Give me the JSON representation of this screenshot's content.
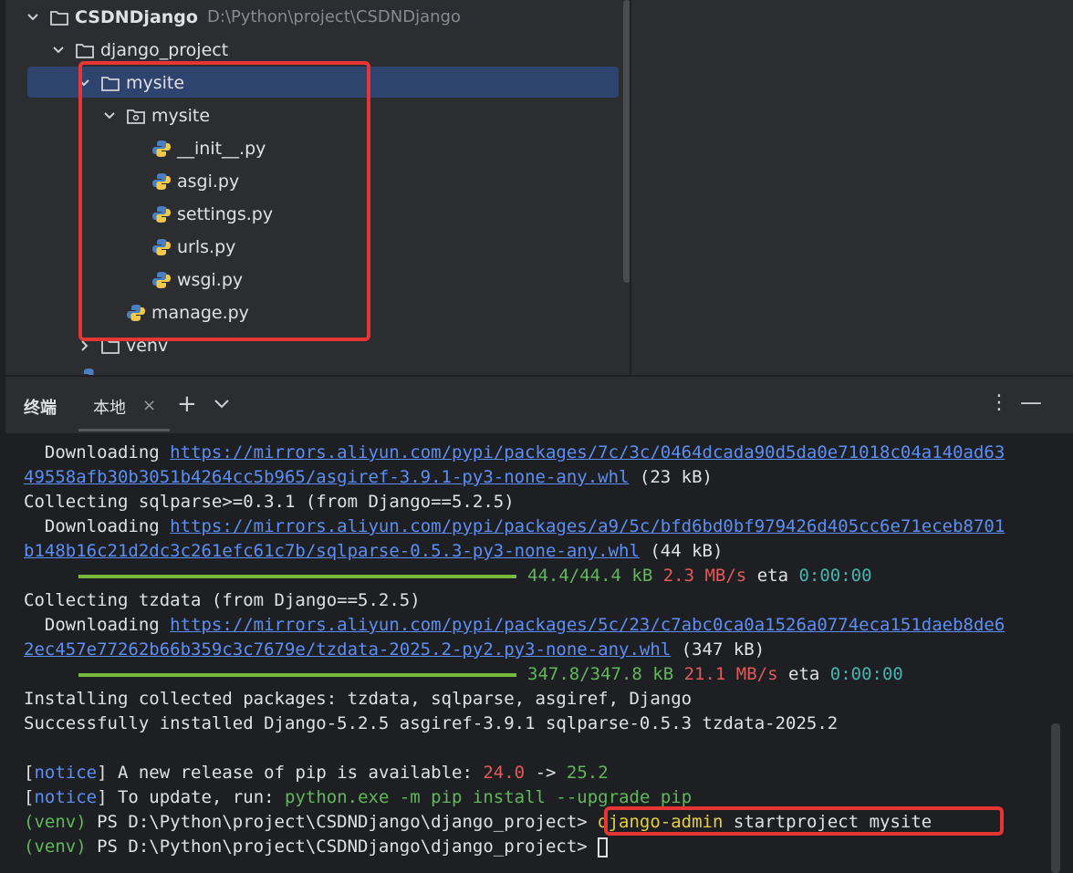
{
  "project_tree": {
    "root": {
      "name": "CSDNDjango",
      "path": "D:\\Python\\project\\CSDNDjango"
    },
    "items": [
      {
        "name": "django_project",
        "type": "folder"
      },
      {
        "name": "mysite",
        "type": "folder"
      },
      {
        "name": "mysite",
        "type": "package"
      },
      {
        "name": "__init__.py",
        "type": "python"
      },
      {
        "name": "asgi.py",
        "type": "python"
      },
      {
        "name": "settings.py",
        "type": "python"
      },
      {
        "name": "urls.py",
        "type": "python"
      },
      {
        "name": "wsgi.py",
        "type": "python"
      },
      {
        "name": "manage.py",
        "type": "python"
      },
      {
        "name": "venv",
        "type": "folder"
      }
    ]
  },
  "terminal_header": {
    "title": "终端",
    "tab_label": "本地",
    "close_glyph": "×",
    "add_glyph": "+",
    "more_glyph": "⋮",
    "minimize_glyph": "—"
  },
  "terminal": {
    "l1_prefix": "  Downloading ",
    "l1_link": "https://mirrors.aliyun.com/pypi/packages/7c/3c/0464dcada90d5da0e71018c04a140ad63",
    "l2_link": "49558afb30b3051b4264cc5b965/asgiref-3.9.1-py3-none-any.whl",
    "l2_size": " (23 kB)",
    "l3": "Collecting sqlparse>=0.3.1 (from Django==5.2.5)",
    "l4_prefix": "  Downloading ",
    "l4_link": "https://mirrors.aliyun.com/pypi/packages/a9/5c/bfd6bd0bf979426d405cc6e71eceb8701",
    "l5_link": "b148b16c21d2dc3c261efc61c7b/sqlparse-0.5.3-py3-none-any.whl",
    "l5_size": " (44 kB)",
    "p1_size": "44.4/44.4 kB",
    "p1_speed": "2.3 MB/s",
    "p1_eta_label": "eta",
    "p1_eta": "0:00:00",
    "l7": "Collecting tzdata (from Django==5.2.5)",
    "l8_prefix": "  Downloading ",
    "l8_link": "https://mirrors.aliyun.com/pypi/packages/5c/23/c7abc0ca0a1526a0774eca151daeb8de6",
    "l9_link": "2ec457e77262b66b359c3c7679e/tzdata-2025.2-py2.py3-none-any.whl",
    "l9_size": " (347 kB)",
    "p2_size": "347.8/347.8 kB",
    "p2_speed": "21.1 MB/s",
    "p2_eta_label": "eta",
    "p2_eta": "0:00:00",
    "l11": "Installing collected packages: tzdata, sqlparse, asgiref, Django",
    "l12": "Successfully installed Django-5.2.5 asgiref-3.9.1 sqlparse-0.5.3 tzdata-2025.2",
    "notice_tag": "notice",
    "n1_text": " A new release of pip is available: ",
    "n1_old": "24.0",
    "n1_arrow": " -> ",
    "n1_new": "25.2",
    "n2_text": " To update, run: ",
    "n2_cmd": "python.exe -m pip install --upgrade pip",
    "venv": "(venv)",
    "prompt": " PS D:\\Python\\project\\CSDNDjango\\django_project>",
    "cmd_name": "django-admin",
    "cmd_args": " startproject mysite",
    "prompt2": " PS D:\\Python\\project\\CSDNDjango\\django_project> "
  }
}
